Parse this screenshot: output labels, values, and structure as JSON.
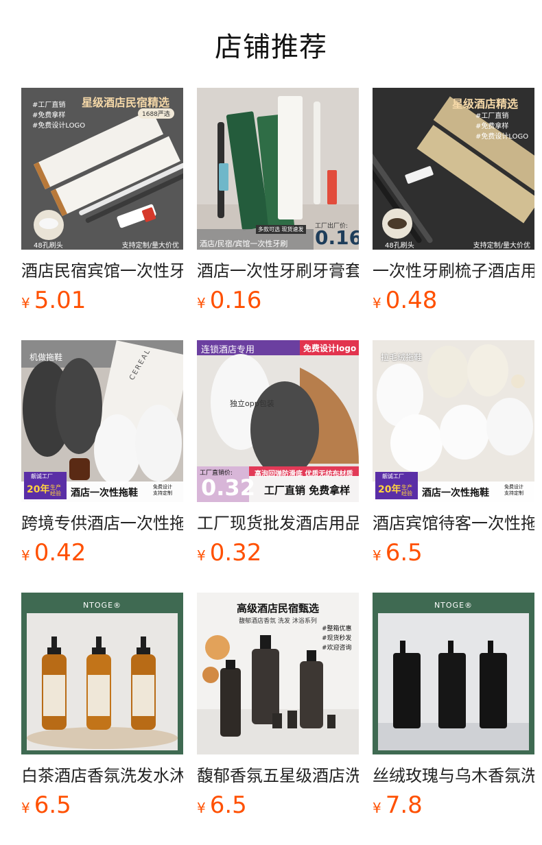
{
  "page": {
    "title": "店铺推荐",
    "currency_symbol": "¥"
  },
  "products": [
    {
      "name": "酒店民宿宾馆一次性牙刷",
      "price": "5.01",
      "banner": "星级酒店民宿精选",
      "tags": [
        "#工厂直销",
        "#免费拿样",
        "#免费设计LOGO"
      ],
      "badge": "1688严选",
      "footer_left": "48孔刷头",
      "footer_right": "支持定制/量大价优"
    },
    {
      "name": "酒店一次性牙刷牙膏套装",
      "price": "0.16",
      "banner": "多款可选 现货速发",
      "price_tag": "工厂出厂价:",
      "price_big": "0.16",
      "footer_left": "酒店/民宿/宾馆一次性牙刷"
    },
    {
      "name": "一次性牙刷梳子酒店用品",
      "price": "0.48",
      "banner": "星级酒店精选",
      "tags": [
        "#工厂直销",
        "#免费拿样",
        "#免费设计LOGO"
      ],
      "footer_left": "48孔刷头",
      "footer_right": "支持定制/量大价优"
    },
    {
      "name": "跨境专供酒店一次性拖鞋",
      "price": "0.42",
      "banner": "机做拖鞋",
      "box_text": "CEREAL",
      "factory": "靓诚工厂",
      "years": "20年",
      "years_note": "生产经验",
      "footer_left": "酒店一次性拖鞋",
      "footer_right": "免费设计 支持定制"
    },
    {
      "name": "工厂现货批发酒店用品拖鞋",
      "price": "0.32",
      "banner_left": "连锁酒店专用",
      "banner_right": "免费设计logo",
      "center_text": "独立opp包装",
      "price_tag": "工厂直销价:",
      "price_big": "0.32",
      "strip": "高泡回弹防滑底 优质无纺布材质",
      "footer_right": "工厂直销 免费拿样"
    },
    {
      "name": "酒店宾馆待客一次性拖鞋",
      "price": "6.5",
      "banner": "拉毛绒拖鞋",
      "factory": "靓诚工厂",
      "years": "20年",
      "years_note": "生产经验",
      "footer_left": "酒店一次性拖鞋",
      "footer_right": "免费设计 支持定制"
    },
    {
      "name": "白茶酒店香氛洗发水沐浴露",
      "price": "6.5",
      "brand": "NTOGE®"
    },
    {
      "name": "馥郁香氛五星级酒店洗发水",
      "price": "6.5",
      "banner": "高级酒店民宿甄选",
      "subbanner": "馥郁酒店香氛 洗发 沐浴系列",
      "tags": [
        "#整箱优惠",
        "#现货秒发",
        "#欢迎咨询"
      ]
    },
    {
      "name": "丝绒玫瑰与乌木香氛洗护",
      "price": "7.8",
      "brand": "NTOGE®"
    }
  ],
  "colors": {
    "price": "#ff5000",
    "title": "#111111",
    "text": "#222222"
  }
}
